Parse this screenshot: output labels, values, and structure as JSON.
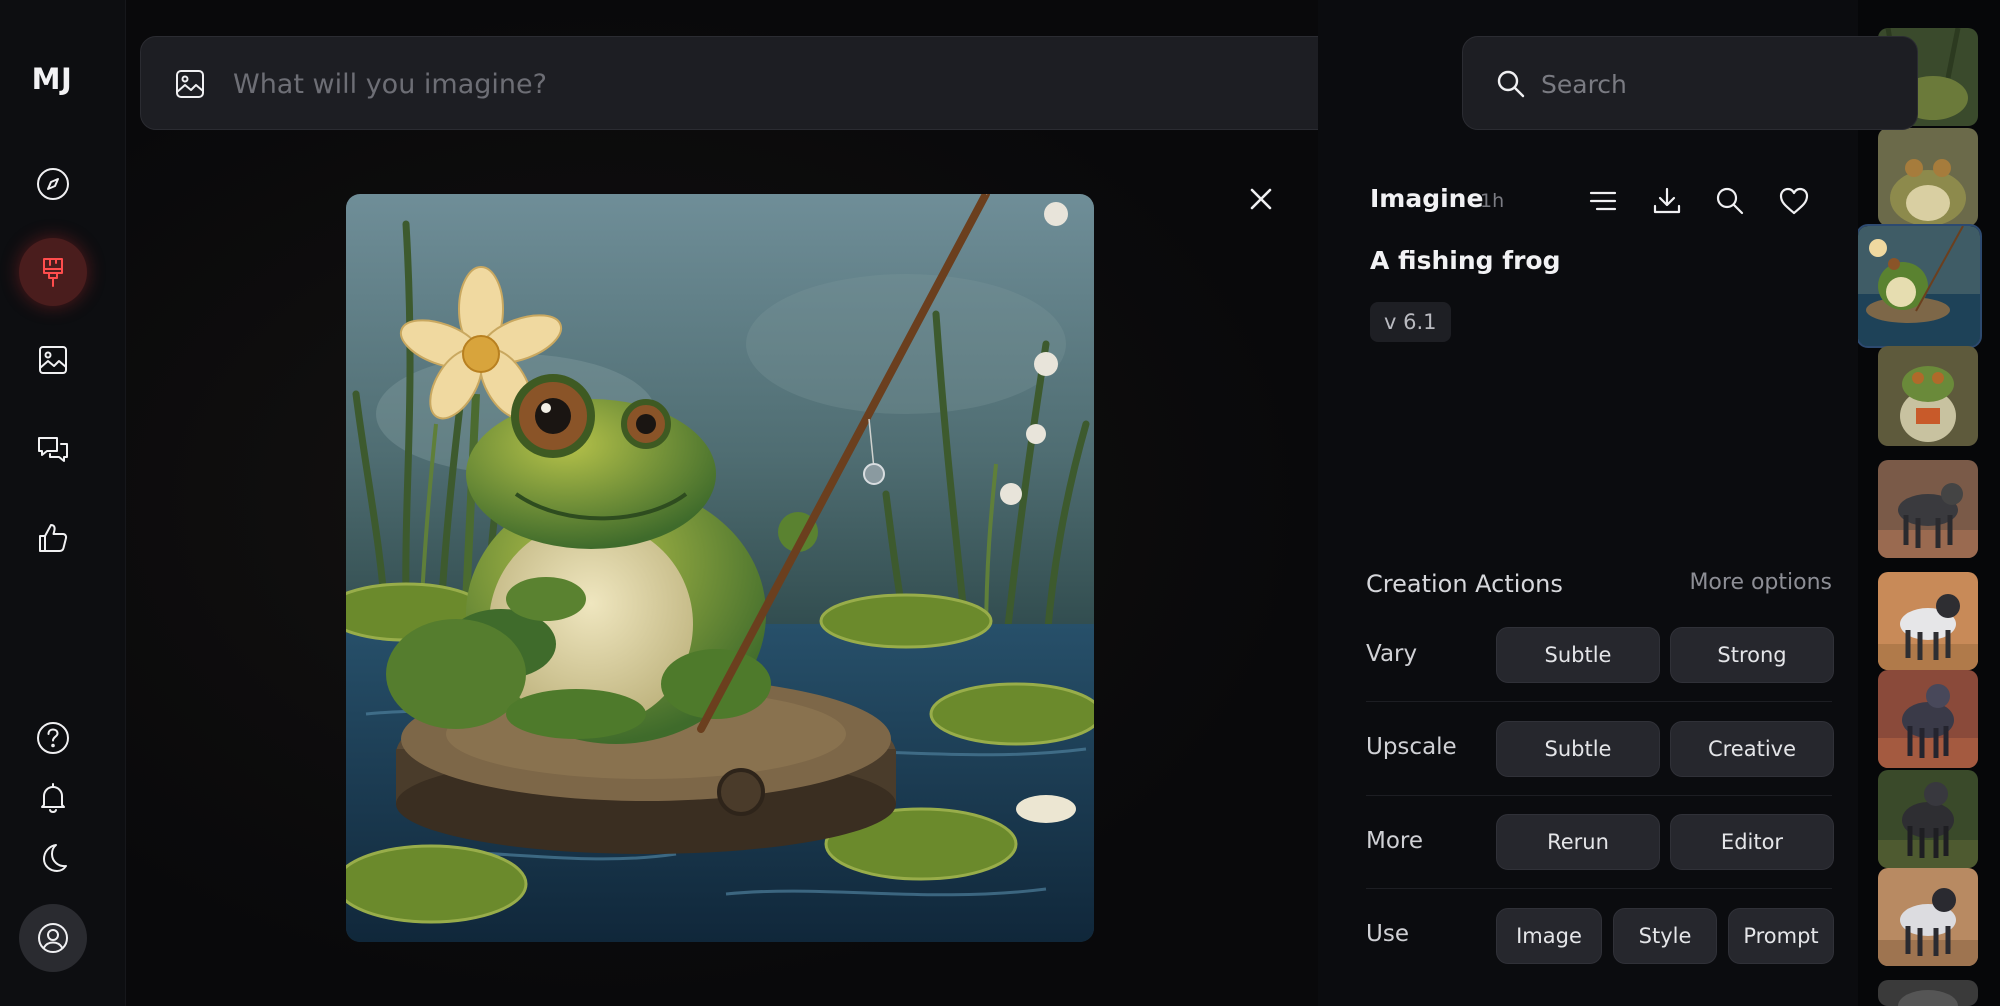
{
  "sidebar": {
    "logo": "MJ",
    "items": [
      {
        "icon": "compass-icon"
      },
      {
        "icon": "paintbrush-icon",
        "active": true
      },
      {
        "icon": "image-icon"
      },
      {
        "icon": "chat-icon"
      },
      {
        "icon": "thumbs-up-icon"
      }
    ],
    "bottom_items": [
      {
        "icon": "help-icon"
      },
      {
        "icon": "bell-icon"
      },
      {
        "icon": "moon-icon"
      },
      {
        "icon": "user-circle-icon"
      }
    ]
  },
  "prompt_bar": {
    "placeholder": "What will you imagine?",
    "icon": "image-icon",
    "settings_icon": "sliders-icon"
  },
  "search": {
    "placeholder": "Search",
    "icon": "search-icon"
  },
  "viewer": {
    "close_icon": "close-icon"
  },
  "details": {
    "title": "Imagine",
    "time": "1h",
    "tools": [
      "filter-lines-icon",
      "download-icon",
      "search-icon",
      "heart-icon"
    ],
    "prompt": "A fishing frog",
    "version": "v 6.1"
  },
  "creation_actions": {
    "title": "Creation Actions",
    "more_options": "More options",
    "rows": [
      {
        "label": "Vary",
        "buttons": [
          "Subtle",
          "Strong"
        ]
      },
      {
        "label": "Upscale",
        "buttons": [
          "Subtle",
          "Creative"
        ]
      },
      {
        "label": "More",
        "buttons": [
          "Rerun",
          "Editor"
        ]
      },
      {
        "label": "Use",
        "buttons": [
          "Image",
          "Style",
          "Prompt"
        ]
      }
    ]
  },
  "colors": {
    "accent_active": "#ff4d4d",
    "panel_bg": "#0b0c0f",
    "button_bg": "#26272d"
  }
}
